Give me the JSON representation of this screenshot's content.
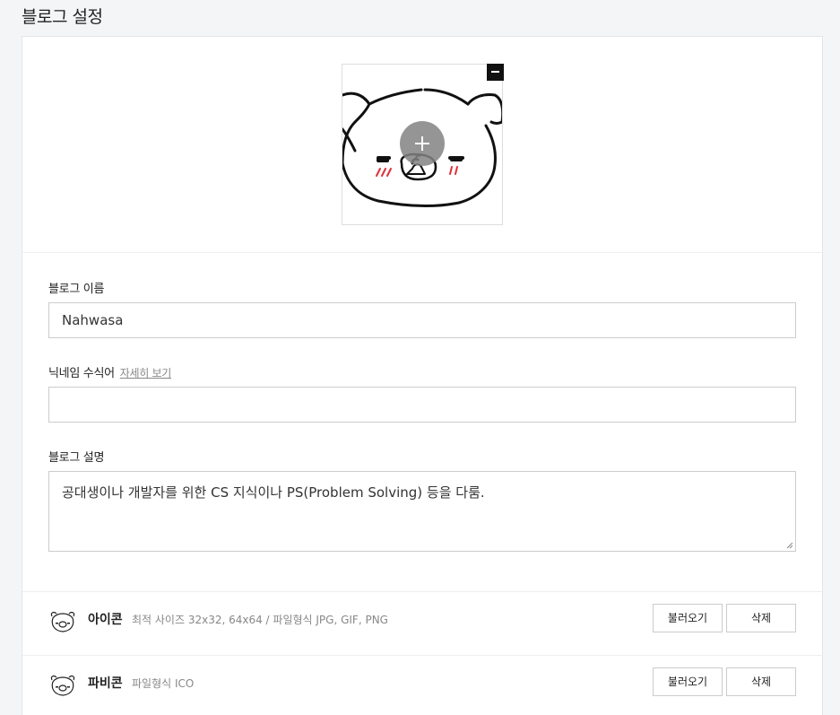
{
  "page": {
    "title": "블로그 설정"
  },
  "profile": {
    "image_name": "bear-doodle-image",
    "remove_icon": "minus-icon",
    "add_icon": "plus-icon"
  },
  "fields": {
    "blog_name": {
      "label": "블로그 이름",
      "value": "Nahwasa"
    },
    "nickname_modifier": {
      "label": "닉네임 수식어",
      "link": "자세히 보기",
      "value": ""
    },
    "blog_description": {
      "label": "블로그 설명",
      "value": "공대생이나 개발자를 위한 CS 지식이나 PS(Problem Solving) 등을 다룸."
    }
  },
  "files": {
    "icon": {
      "title": "아이콘",
      "desc": "최적 사이즈 32x32, 64x64 / 파일형식 JPG, GIF, PNG",
      "load_label": "불러오기",
      "delete_label": "삭제"
    },
    "favicon": {
      "title": "파비콘",
      "desc": "파일형식 ICO",
      "load_label": "불러오기",
      "delete_label": "삭제"
    }
  },
  "colors": {
    "background": "#f4f5f7",
    "panel": "#ffffff",
    "border": "#cccccc",
    "blush": "#e0303a"
  }
}
